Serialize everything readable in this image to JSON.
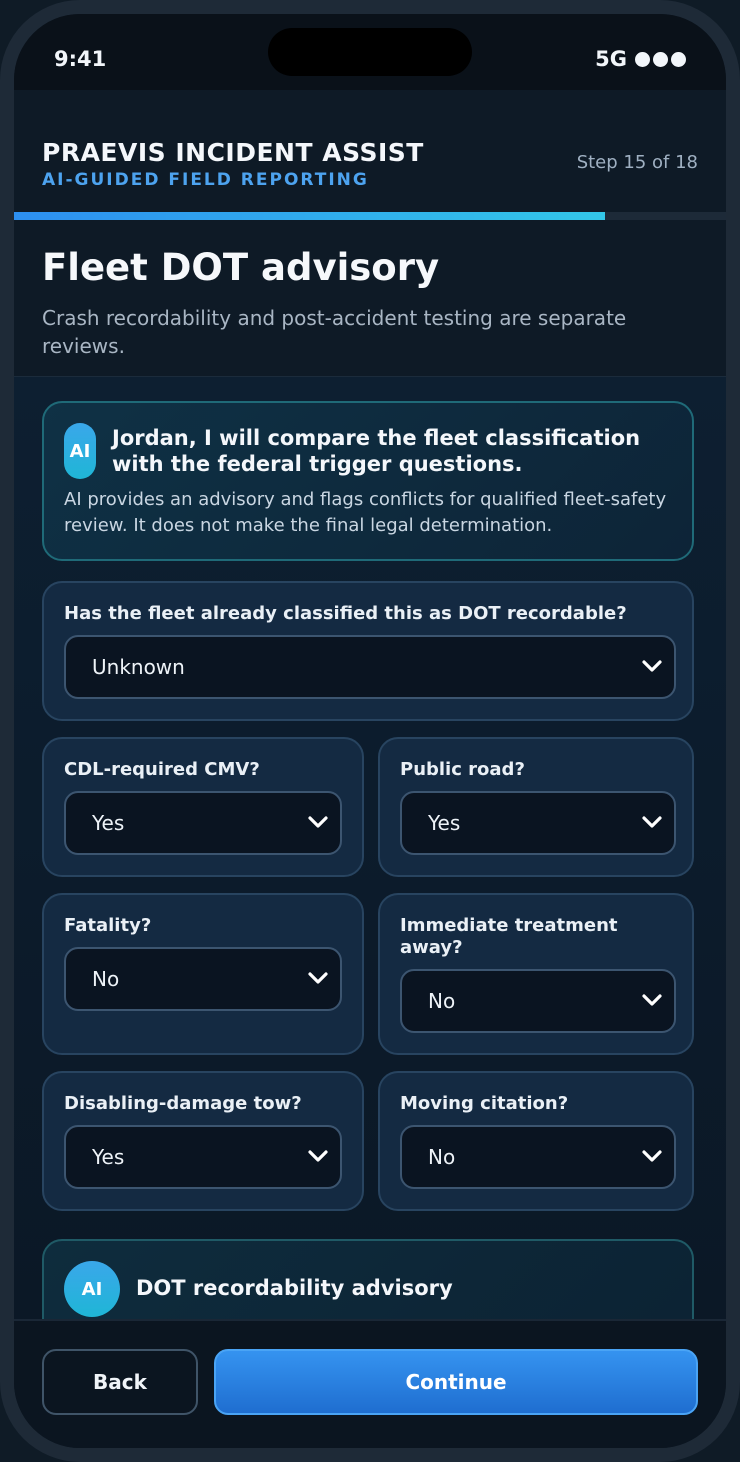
{
  "status_bar": {
    "time": "9:41",
    "network": "5G"
  },
  "header": {
    "app_title": "PRAEVIS INCIDENT ASSIST",
    "app_subtitle": "AI-GUIDED FIELD REPORTING",
    "step": "Step 15 of 18",
    "progress_fraction": 0.83
  },
  "page": {
    "title": "Fleet DOT advisory",
    "description": "Crash recordability and post-accident testing are separate reviews."
  },
  "ai_intro": {
    "badge": "AI",
    "headline": "Jordan, I will compare the fleet classification with the federal trigger questions.",
    "body": "AI provides an advisory and flags conflicts for qualified fleet-safety review. It does not make the final legal determination."
  },
  "questions": {
    "fleet_classified": {
      "label": "Has the fleet already classified this as DOT recordable?",
      "value": "Unknown"
    },
    "cdl_cmv": {
      "label": "CDL-required CMV?",
      "value": "Yes"
    },
    "public_road": {
      "label": "Public road?",
      "value": "Yes"
    },
    "fatality": {
      "label": "Fatality?",
      "value": "No"
    },
    "treatment_away": {
      "label": "Immediate treatment away?",
      "value": "No"
    },
    "disabling_tow": {
      "label": "Disabling-damage tow?",
      "value": "Yes"
    },
    "moving_citation": {
      "label": "Moving citation?",
      "value": "No"
    }
  },
  "advisory": {
    "badge": "AI",
    "title": "DOT recordability advisory"
  },
  "footer": {
    "back_label": "Back",
    "continue_label": "Continue"
  },
  "colors": {
    "accent": "#2d8ff0",
    "accent_cyan": "#33c7e8",
    "subtitle": "#4da3ef",
    "background": "#0b1520"
  }
}
